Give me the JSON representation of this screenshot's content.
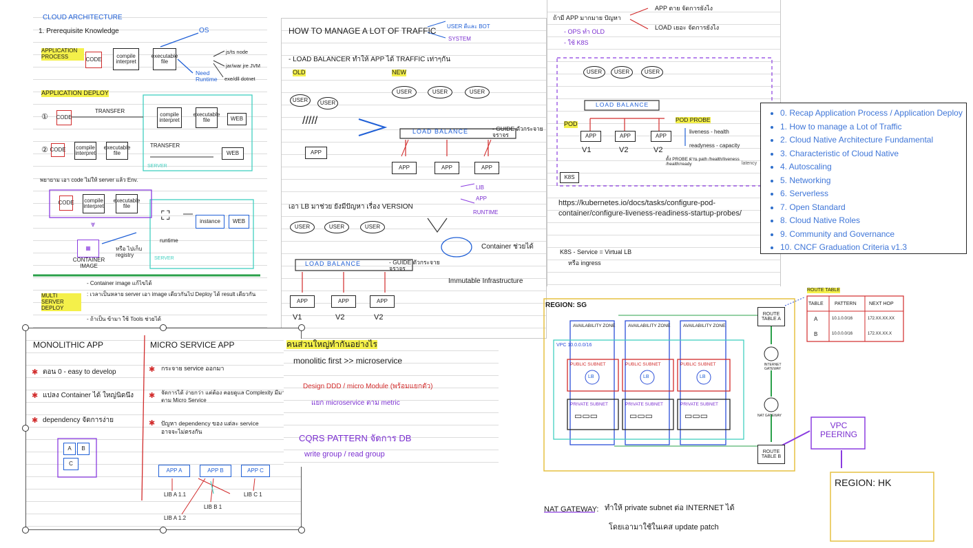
{
  "toc": {
    "items": [
      "0. Recap Application Process / Application Deploy",
      "1. How to manage a Lot of Traffic",
      "2. Cloud Native Architecture Fundamental",
      "3. Characteristic of Cloud Native",
      "4. Autoscaling",
      "5. Networking",
      "6. Serverless",
      "7. Open Standard",
      "8. Cloud Native Roles",
      "9. Community and Governance",
      "10. CNCF Graduation Criteria v1.3"
    ]
  },
  "note1": {
    "title": "CLOUD ARCHITECTURE",
    "prereq": "1. Prerequisite Knowledge",
    "app_process": "APPLICATION PROCESS",
    "code": "CODE",
    "compile": "compile interpret",
    "exe": "executable file",
    "os": "OS",
    "need_runtime": "Need Runtime",
    "runtimes": [
      "js/ts node",
      "jar/war jre JVM",
      "exe/dll dotnet"
    ],
    "app_deploy": "APPLICATION DEPLOY",
    "transfer": "TRANSFER",
    "web": "WEB",
    "server": "SERVER",
    "step3": "พยายาม เอา code ไม่ให้ server แล้ว Env.",
    "instance": "instance",
    "runtime": "runtime",
    "container_image": "CONTAINER IMAGE",
    "registry": "หรือ ไปเก็บ registry",
    "multi_server": "MULTI SERVER DEPLOY",
    "bullets": [
      "- Container image แก้ไขได้",
      ": เวลาเป็นหลาย server เอา image เดียวกันไป Deploy ได้ result เดียวกัน",
      "- ถ้าเป็น ข้ามา ใช้ Tools ช่วยได้"
    ]
  },
  "note2": {
    "title": "HOW TO MANAGE A LOT OF TRAFFIC",
    "user_bot": "USER ดีและ BOT",
    "system": "SYSTEM",
    "lb_line": "- LOAD BALANCER ทำให้ APP ได้ TRAFFIC เท่าๆกัน",
    "old": "OLD",
    "new": "NEW",
    "user": "USER",
    "app": "APP",
    "load_balance": "LOAD BALANCE",
    "guide": "- GUIDE ตัวกระจายจราจร",
    "lb_version": "เอา LB มาช่วย ยังมีปัญหา เรื่อง VERSION",
    "lib": "LIB",
    "runtime": "RUNTIME",
    "container_ok": "Container ช่วยได้",
    "immutable": "Immutable Infrastructure",
    "versions": [
      "V1",
      "V2",
      "V2"
    ]
  },
  "note3": {
    "header": "ถ้ามี APP มากมาย ปัญหา",
    "app_die": "APP ตาย จัดการยังไง",
    "load_manage": "LOAD เยอะ จัดการยังไง",
    "ops": "- OPS ทำ OLD",
    "k8s_use": "- ใช้ K8S",
    "pod": "POD",
    "pod_probe": "POD PROBE",
    "liveness": "liveness - health",
    "readyness": "readyness - capacity",
    "probe_note": "ตั้ง PROBE ผ่าน path /health/liveness /health/ready",
    "latency": "latency",
    "k8s_label": "K8S",
    "url": "https://kubernetes.io/docs/tasks/configure-pod-container/configure-liveness-readiness-startup-probes/",
    "service": "K8S - Service = Virtual LB",
    "ingress": "หรือ ingress",
    "versions": [
      "V1",
      "V2",
      "V2"
    ]
  },
  "note4": {
    "monolithic": "MONOLITHIC APP",
    "microservice": "MICRO SERVICE APP",
    "mono_points": [
      "ตอน 0 - easy to develop",
      "แปลง Container ได้ ใหญ่นิดนึง",
      "dependency จัดการง่าย"
    ],
    "micro_points": [
      "กระจาย service ออกมา",
      "จัดการได้ ง่ายกว่า แต่ต้อง คอยดูแล Complexity มีมากขึ้นตาม Micro Service",
      "ปัญหา dependency ของ แต่ละ service อาจจะไม่ตรงกัน"
    ],
    "apps": [
      "APP A",
      "APP B",
      "APP C"
    ],
    "libs": [
      "LIB A 1.1",
      "LIB B 1",
      "LIB C 1",
      "LIB A 1.2"
    ],
    "mono_boxes": [
      "A",
      "B",
      "C"
    ]
  },
  "note5": {
    "title": "คนส่วนใหญ่ทำกันอย่างไร",
    "line1": "monolitic first >> microservice",
    "line2": "Design DDD / micro Module (พร้อมแยกตัว)",
    "line3": "แยก microservice ตาม metric",
    "cqrs": "CQRS PATTERN จัดการ DB",
    "write_read": "write group / read group"
  },
  "note6": {
    "region_sg": "REGION: SG",
    "az": "AVAILABILITY ZONE",
    "vpc": "VPC 10.0.0.0/16",
    "public_subnet": "PUBLIC SUBNET",
    "private_subnet": "PRIVATE SUBNET",
    "lb": "LB",
    "route_a": "ROUTE TABLE A",
    "route_b": "ROUTE TABLE B",
    "igw": "INTERNET GATEWAY",
    "nat": "NAT GATEWAY",
    "route_table_title": "ROUTE TABLE",
    "rt_headers": [
      "TABLE",
      "PATTERN",
      "NEXT HOP"
    ],
    "rt_rows": [
      [
        "A",
        "10.1.0.0/16",
        "172.XX.XX.XX"
      ],
      [
        "B",
        "10.0.0.0/16",
        "172.XX.XX.X"
      ]
    ],
    "vpc_peering": "VPC PEERING",
    "region_hk": "REGION: HK",
    "nat_note_label": "NAT GATEWAY:",
    "nat_note_1": "ทำให้ private subnet ต่อ INTERNET ได้",
    "nat_note_2": "โดยเอามาใช้ในเคส update patch"
  },
  "colors": {
    "link": "#2f6fcc",
    "highlight": "#f4f04a",
    "purple": "#7b2fd0",
    "red": "#d12a2a",
    "teal": "#40d0c0",
    "green": "#2aa04a"
  }
}
